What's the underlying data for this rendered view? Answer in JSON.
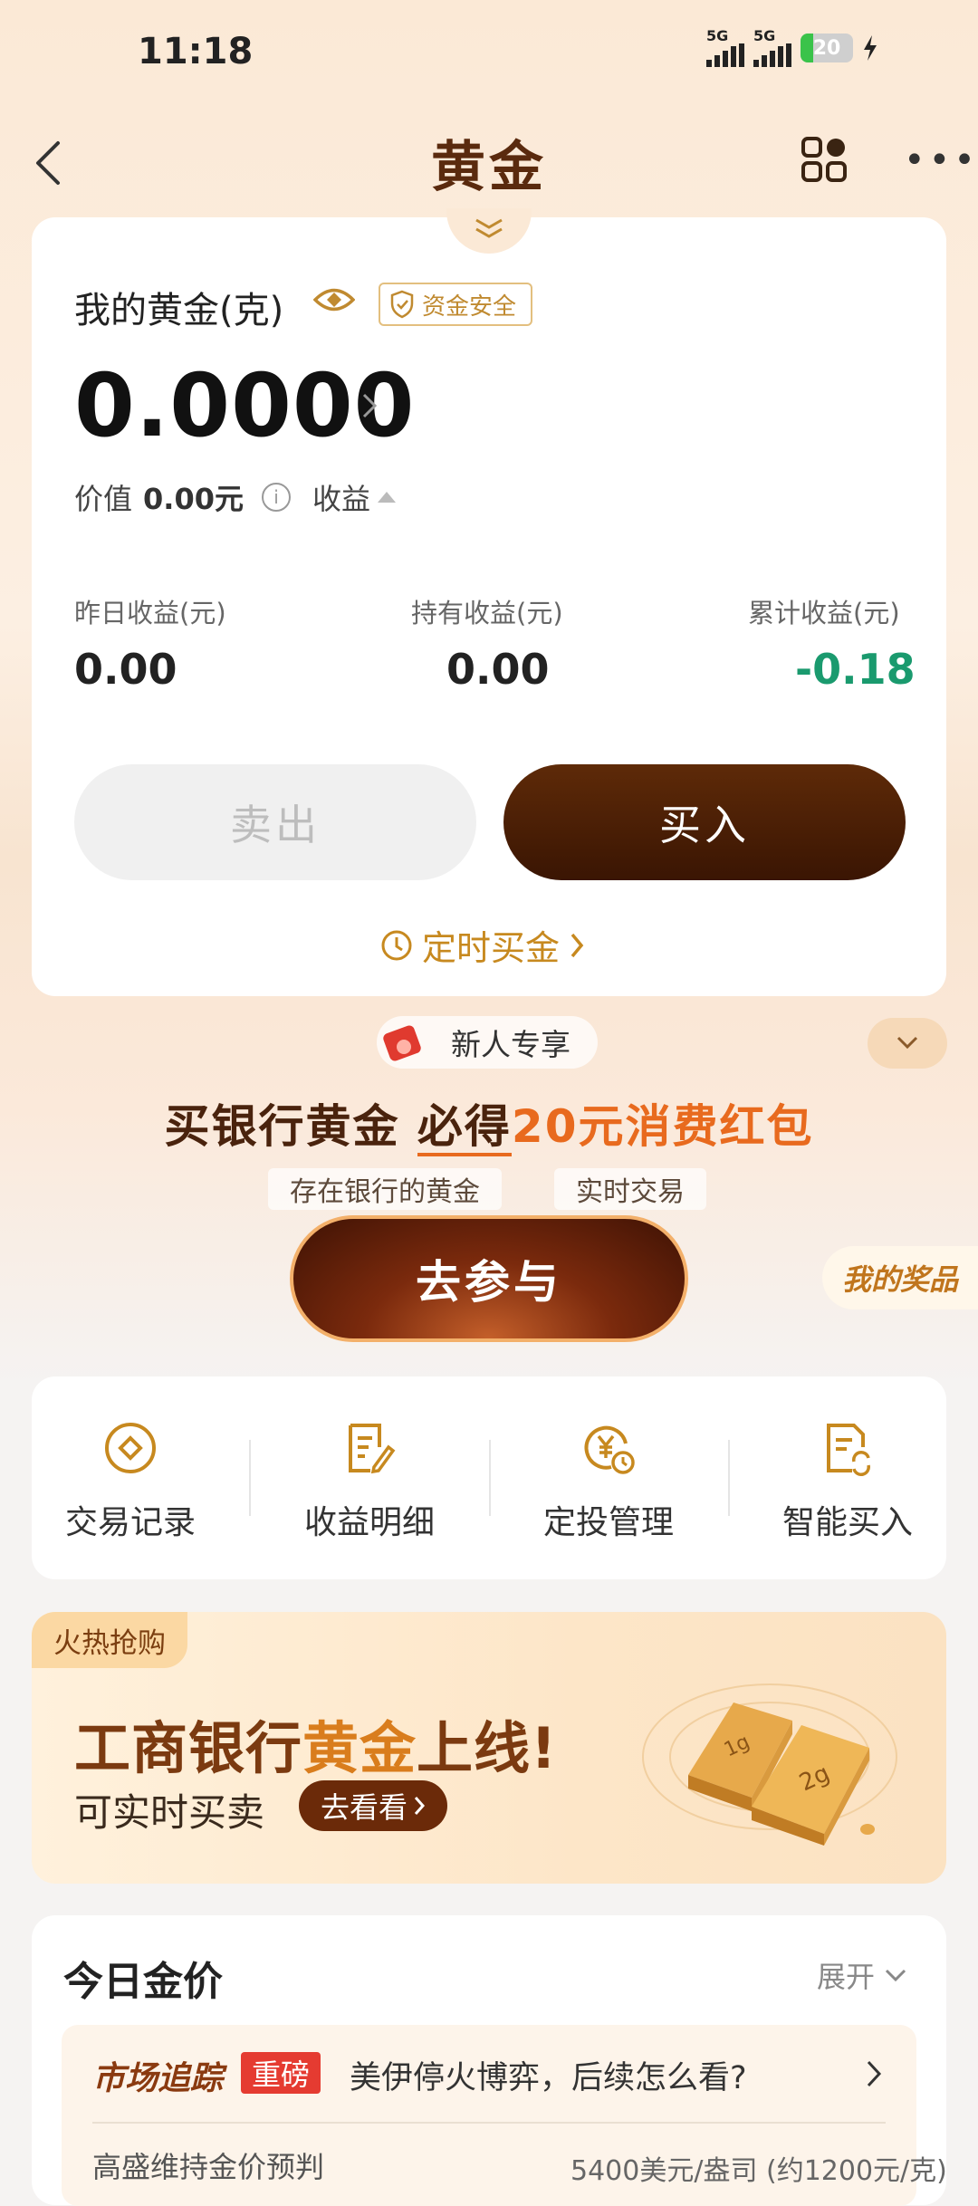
{
  "status_bar": {
    "time": "11:18",
    "net1": "5G",
    "net2": "5G",
    "battery": "20"
  },
  "header": {
    "title": "黄金"
  },
  "holdings": {
    "label": "我的黄金(克)",
    "safety_badge": "资金安全",
    "grams": "0.0000",
    "value_label": "价值",
    "value_amount": "0.00元",
    "income_label": "收益",
    "stats": [
      {
        "label": "昨日收益(元)",
        "value": "0.00"
      },
      {
        "label": "持有收益(元)",
        "value": "0.00"
      },
      {
        "label": "累计收益(元)",
        "value": "-0.18"
      }
    ],
    "sell_label": "卖出",
    "buy_label": "买入",
    "timed_buy_label": "定时买金"
  },
  "promo": {
    "newbie_label": "新人专享",
    "title_part1": "买银行黄金 ",
    "title_part2": "必得",
    "title_part3": "20元消费红包",
    "tags": [
      "存在银行的黄金",
      "实时交易"
    ],
    "join_label": "去参与",
    "my_prize_label": "我的奖品"
  },
  "quick_menu": {
    "items": [
      {
        "label": "交易记录",
        "icon": "circle-diamond-icon"
      },
      {
        "label": "收益明细",
        "icon": "edit-document-icon"
      },
      {
        "label": "定投管理",
        "icon": "yuan-clock-icon"
      },
      {
        "label": "智能买入",
        "icon": "document-refresh-icon"
      }
    ]
  },
  "banner": {
    "hot_tag": "火热抢购",
    "title_part1": "工商银行",
    "title_part2": "黄金",
    "title_part3": "上线!",
    "subtitle": "可实时买卖",
    "go_label": "去看看",
    "bar_labels": [
      "1g",
      "2g"
    ]
  },
  "today_price": {
    "title": "今日金价",
    "expand_label": "展开",
    "news_brand": "市场追踪",
    "news_tag": "重磅",
    "news_text": "美伊停火博弈，后续怎么看?",
    "news2_left": "高盛维持金价预判",
    "news2_right": "5400美元/盎司 (约1200元/克)"
  },
  "colors": {
    "brand": "#5a2a0e",
    "accent_gold": "#c7891f",
    "negative_green": "#1a9a6e",
    "buy_bg": "#4a1c05"
  }
}
